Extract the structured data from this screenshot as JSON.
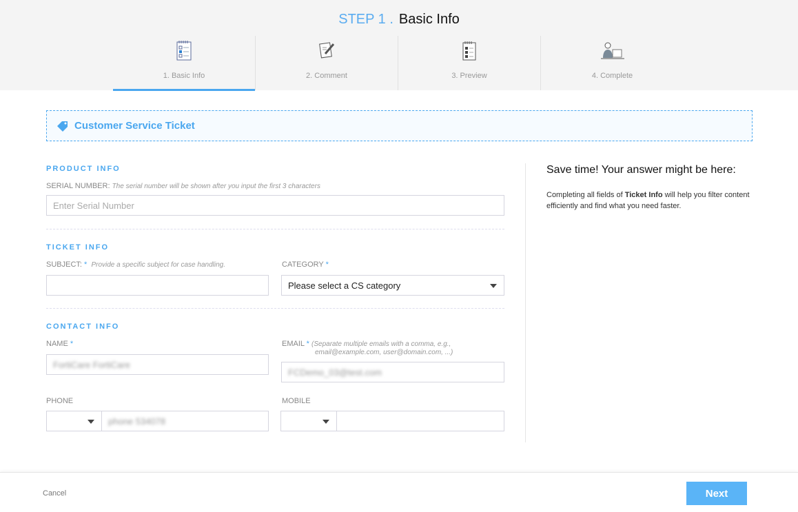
{
  "header": {
    "step_prefix": "STEP 1 .",
    "step_title": "Basic Info",
    "steps": [
      {
        "label": "1. Basic Info"
      },
      {
        "label": "2. Comment"
      },
      {
        "label": "3. Preview"
      },
      {
        "label": "4. Complete"
      }
    ]
  },
  "banner": {
    "title": "Customer Service Ticket"
  },
  "product": {
    "heading": "PRODUCT INFO",
    "serial_label": "SERIAL NUMBER:",
    "serial_hint": "The serial number will be shown after you input the first 3 characters",
    "serial_placeholder": "Enter Serial Number"
  },
  "ticket": {
    "heading": "TICKET INFO",
    "subject_label": "SUBJECT:",
    "subject_hint": "Provide a specific subject for case handling.",
    "category_label": "CATEGORY",
    "category_value": "Please select a CS category",
    "star": "*"
  },
  "contact": {
    "heading": "CONTACT INFO",
    "name_label": "NAME",
    "name_value": "FortiCare FortiCare",
    "email_label": "EMAIL",
    "email_hint": "(Separate multiple emails with a comma, e.g.,",
    "email_hint2": "email@example.com, user@domain.com, ...)",
    "email_value": "FCDemo_03@test.com",
    "phone_label": "PHONE",
    "phone_value": "phone 534078",
    "mobile_label": "MOBILE"
  },
  "side": {
    "title": "Save time! Your answer might be here:",
    "text_pre": "Completing all fields of ",
    "text_bold": "Ticket Info",
    "text_post": " will help you filter content efficiently and find what you need faster."
  },
  "footer": {
    "cancel": "Cancel",
    "next": "Next"
  }
}
